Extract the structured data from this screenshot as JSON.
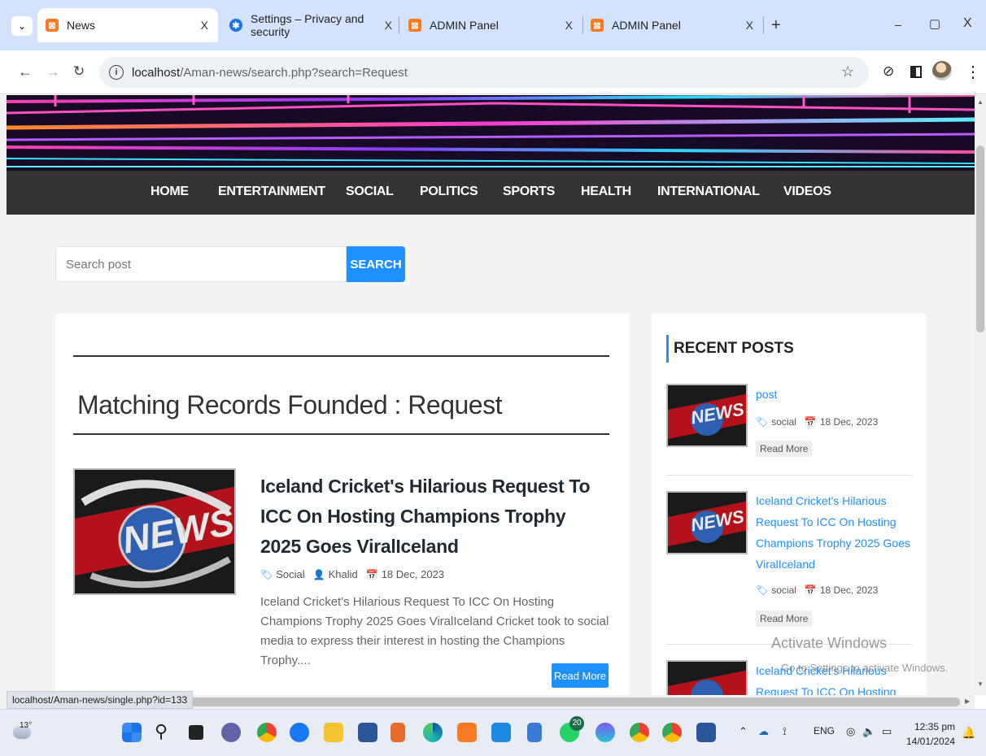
{
  "browser": {
    "tabs": [
      {
        "title": "News",
        "active": true
      },
      {
        "title": "Settings – Privacy and security",
        "active": false
      },
      {
        "title": "ADMIN Panel",
        "active": false
      },
      {
        "title": "ADMIN Panel",
        "active": false
      }
    ],
    "tab_close": "X",
    "new_tab": "+",
    "url_host": "localhost",
    "url_path": "/Aman-news/search.php?search=Request",
    "status_url": "localhost/Aman-news/single.php?id=133",
    "window_controls": {
      "minimize": "–",
      "maximize": "▢",
      "close": "X"
    },
    "colors": {
      "tabstrip": "#d3e3fd",
      "omnibox": "#eef1f6"
    }
  },
  "site": {
    "nav": [
      "HOME",
      "ENTERTAINMENT",
      "SOCIAL",
      "POLITICS",
      "SPORTS",
      "HEALTH",
      "INTERNATIONAL",
      "VIDEOS"
    ],
    "search": {
      "placeholder": "Search post",
      "button": "SEARCH"
    },
    "results_heading": "Matching Records Founded : Request",
    "post": {
      "title": "Iceland Cricket's Hilarious Request To ICC On Hosting Champions Trophy 2025 Goes ViralIceland",
      "category": "Social",
      "author": "Khalid",
      "date": "18 Dec, 2023",
      "excerpt": "Iceland Cricket's Hilarious Request To ICC On Hosting Champions Trophy 2025 Goes ViralIceland Cricket took to social media to express their interest in hosting the Champions Trophy....",
      "read_more": "Read More"
    },
    "recent": {
      "heading": "RECENT POSTS",
      "items": [
        {
          "title": "post",
          "category": "social",
          "date": "18 Dec, 2023",
          "read_more": "Read More"
        },
        {
          "title": "Iceland Cricket's Hilarious Request To ICC On Hosting Champions Trophy 2025 Goes ViralIceland",
          "category": "social",
          "date": "18 Dec, 2023",
          "read_more": "Read More"
        },
        {
          "title": "Iceland Cricket's Hilarious Request To ICC On Hosting"
        }
      ]
    },
    "colors": {
      "accent": "#1e90ff",
      "navbar": "#343434"
    }
  },
  "watermark": {
    "line1": "Activate Windows",
    "line2": "Go to Settings to activate Windows."
  },
  "taskbar": {
    "weather": "13°",
    "badge": "20",
    "lang": "ENG",
    "time": "12:35 pm",
    "date": "14/01/2024"
  }
}
